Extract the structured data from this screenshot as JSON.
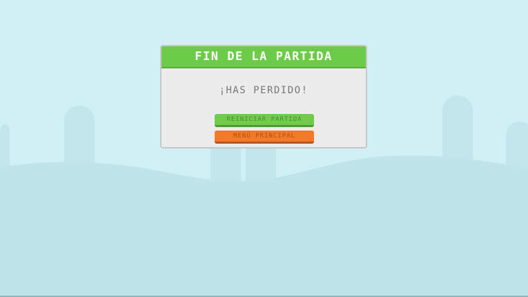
{
  "dialog": {
    "title": "FIN DE LA PARTIDA",
    "message": "¡HAS PERDIDO!",
    "buttons": {
      "restart_label": "REINICIAR PARTIDA",
      "menu_label": "MENÚ PRINCIPAL"
    }
  },
  "colors": {
    "sky": "#cff0f5",
    "ground": "#bfe5ea",
    "header": "#6ccc4a",
    "restart_button": "#72cc4c",
    "menu_button": "#f07a2a"
  }
}
